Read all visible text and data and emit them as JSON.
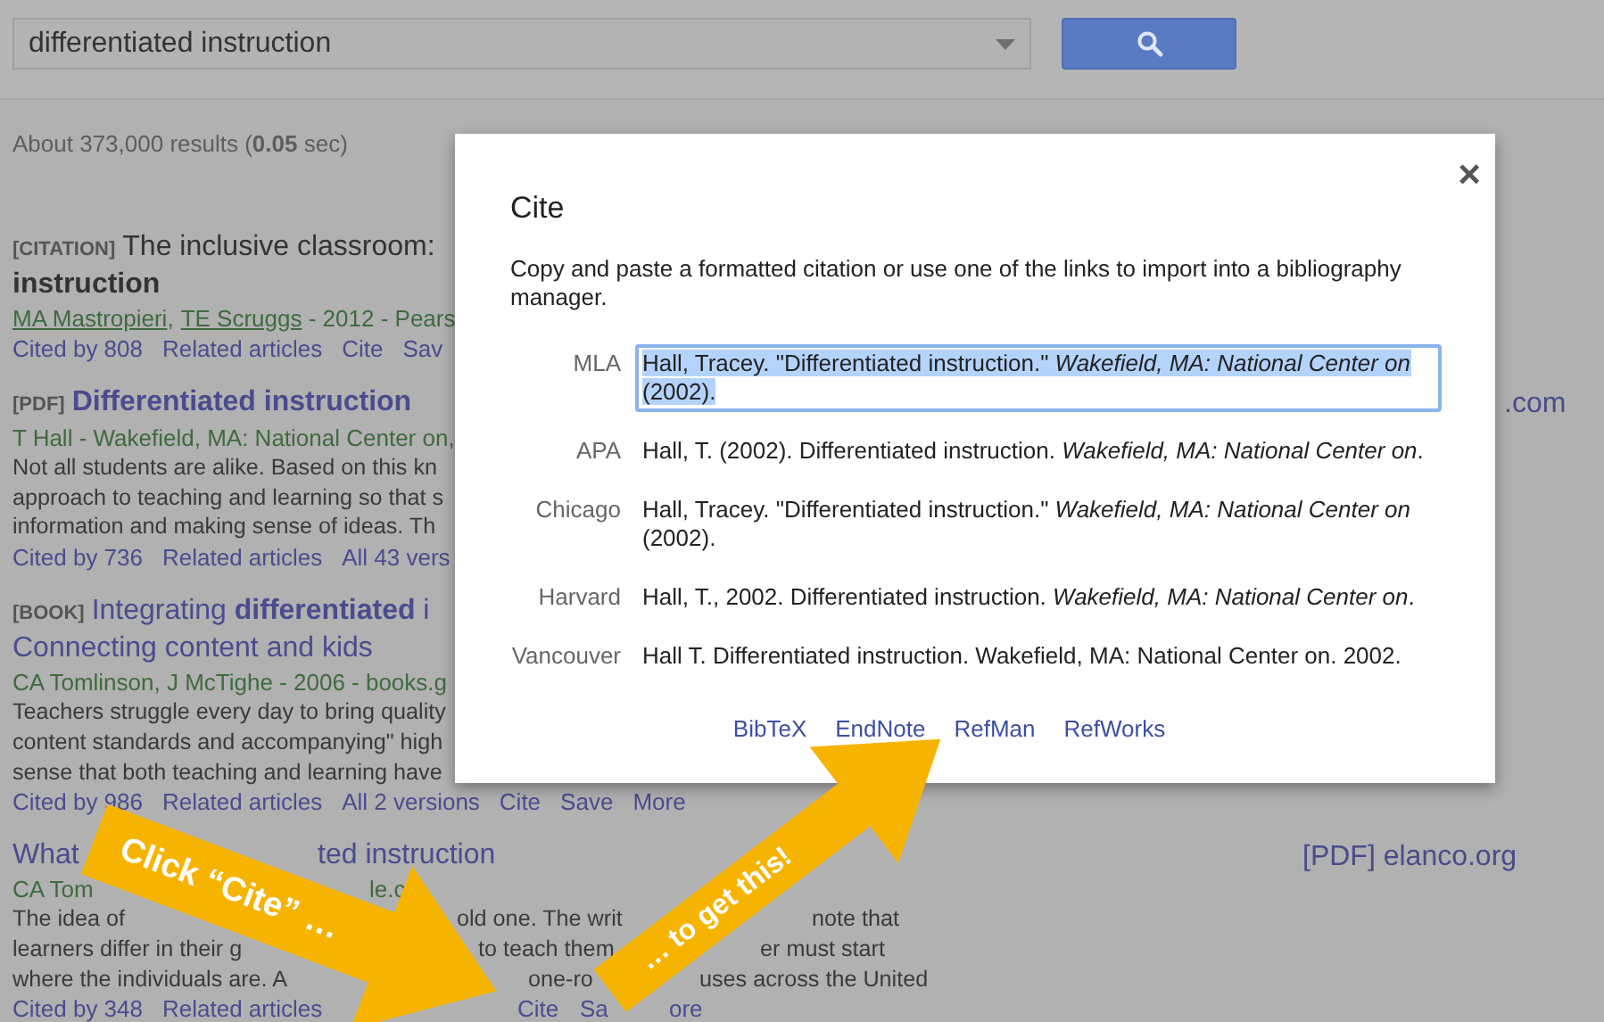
{
  "search": {
    "value": "differentiated instruction"
  },
  "result_count": "About 373,000 results (**0.05** sec)",
  "results": [
    {
      "kind": "normal",
      "type_tag": "[CITATION]",
      "linked": false,
      "title_lines": [
        "The inclusive classroom:",
        "**instruction**"
      ],
      "authors": [
        "MA Mastropieri",
        "TE Scruggs"
      ],
      "separator": ",",
      "source": " - 2012 - Pears",
      "links": [
        "Cited by 808",
        "Related articles",
        "Cite",
        "Sav"
      ]
    },
    {
      "kind": "normal",
      "type_tag": "[PDF]",
      "linked": true,
      "title_lines": [
        "**Differentiated instruction**"
      ],
      "source": "T Hall - Wakefield, MA: National Center on,",
      "snippet": [
        "Not all students are alike. Based on this kn",
        "approach to teaching and learning so that s",
        "information and making sense of ideas. Th"
      ],
      "links": [
        "Cited by 736",
        "Related articles",
        "All 43 vers"
      ],
      "side": ".com"
    },
    {
      "kind": "normal",
      "type_tag": "[BOOK]",
      "linked": true,
      "title_lines": [
        "Integrating **differentiated** i",
        "Connecting content and kids"
      ],
      "source": "CA Tomlinson, J McTighe - 2006 - books.g",
      "snippet": [
        "Teachers struggle every day to bring quality",
        "content standards and accompanying\" high",
        "sense that both teaching and learning have"
      ],
      "links": [
        "Cited by 986",
        "Related articles",
        "All 2 versions",
        "Cite",
        "Save",
        "More"
      ]
    },
    {
      "kind": "fragments",
      "side": "[PDF] elanco.org",
      "lines": [
        {
          "kind": "title",
          "parts": [
            "What",
            "ted instruction"
          ]
        },
        {
          "kind": "source",
          "parts": [
            "CA Tom",
            "le.c"
          ]
        },
        {
          "kind": "snippet",
          "parts": [
            "The idea of",
            "old one. The writ",
            "note that"
          ]
        },
        {
          "kind": "snippet",
          "parts": [
            "learners differ in their g",
            "to teach them",
            "er must start"
          ]
        },
        {
          "kind": "snippet",
          "parts": [
            "where the individuals are. A",
            "one-ro",
            "uses across the United"
          ]
        },
        {
          "kind": "links",
          "parts": [
            "Cited by 348",
            "Related articles",
            "Cite",
            "Sa",
            "ore"
          ]
        }
      ]
    }
  ],
  "dialog": {
    "title": "Cite",
    "close": "×",
    "description": "Copy and paste a formatted citation or use one of the links to import into a bibliography manager.",
    "citations": [
      {
        "style": "MLA",
        "text": "Hall, Tracey. \"Differentiated instruction.\" *Wakefield, MA: National Center on* (2002).",
        "selected": true
      },
      {
        "style": "APA",
        "text": "Hall, T. (2002). Differentiated instruction. *Wakefield, MA: National Center on*.",
        "selected": false
      },
      {
        "style": "Chicago",
        "text": "Hall, Tracey. \"Differentiated instruction.\" *Wakefield, MA: National Center on* (2002).",
        "selected": false
      },
      {
        "style": "Harvard",
        "text": "Hall, T., 2002. Differentiated instruction. *Wakefield, MA: National Center on*.",
        "selected": false
      },
      {
        "style": "Vancouver",
        "text": "Hall T. Differentiated instruction. Wakefield, MA: National Center on. 2002.",
        "selected": false
      }
    ],
    "export_links": [
      "BibTeX",
      "EndNote",
      "RefMan",
      "RefWorks"
    ]
  },
  "annotations": [
    "Click “Cite” …",
    "… to get this!"
  ]
}
